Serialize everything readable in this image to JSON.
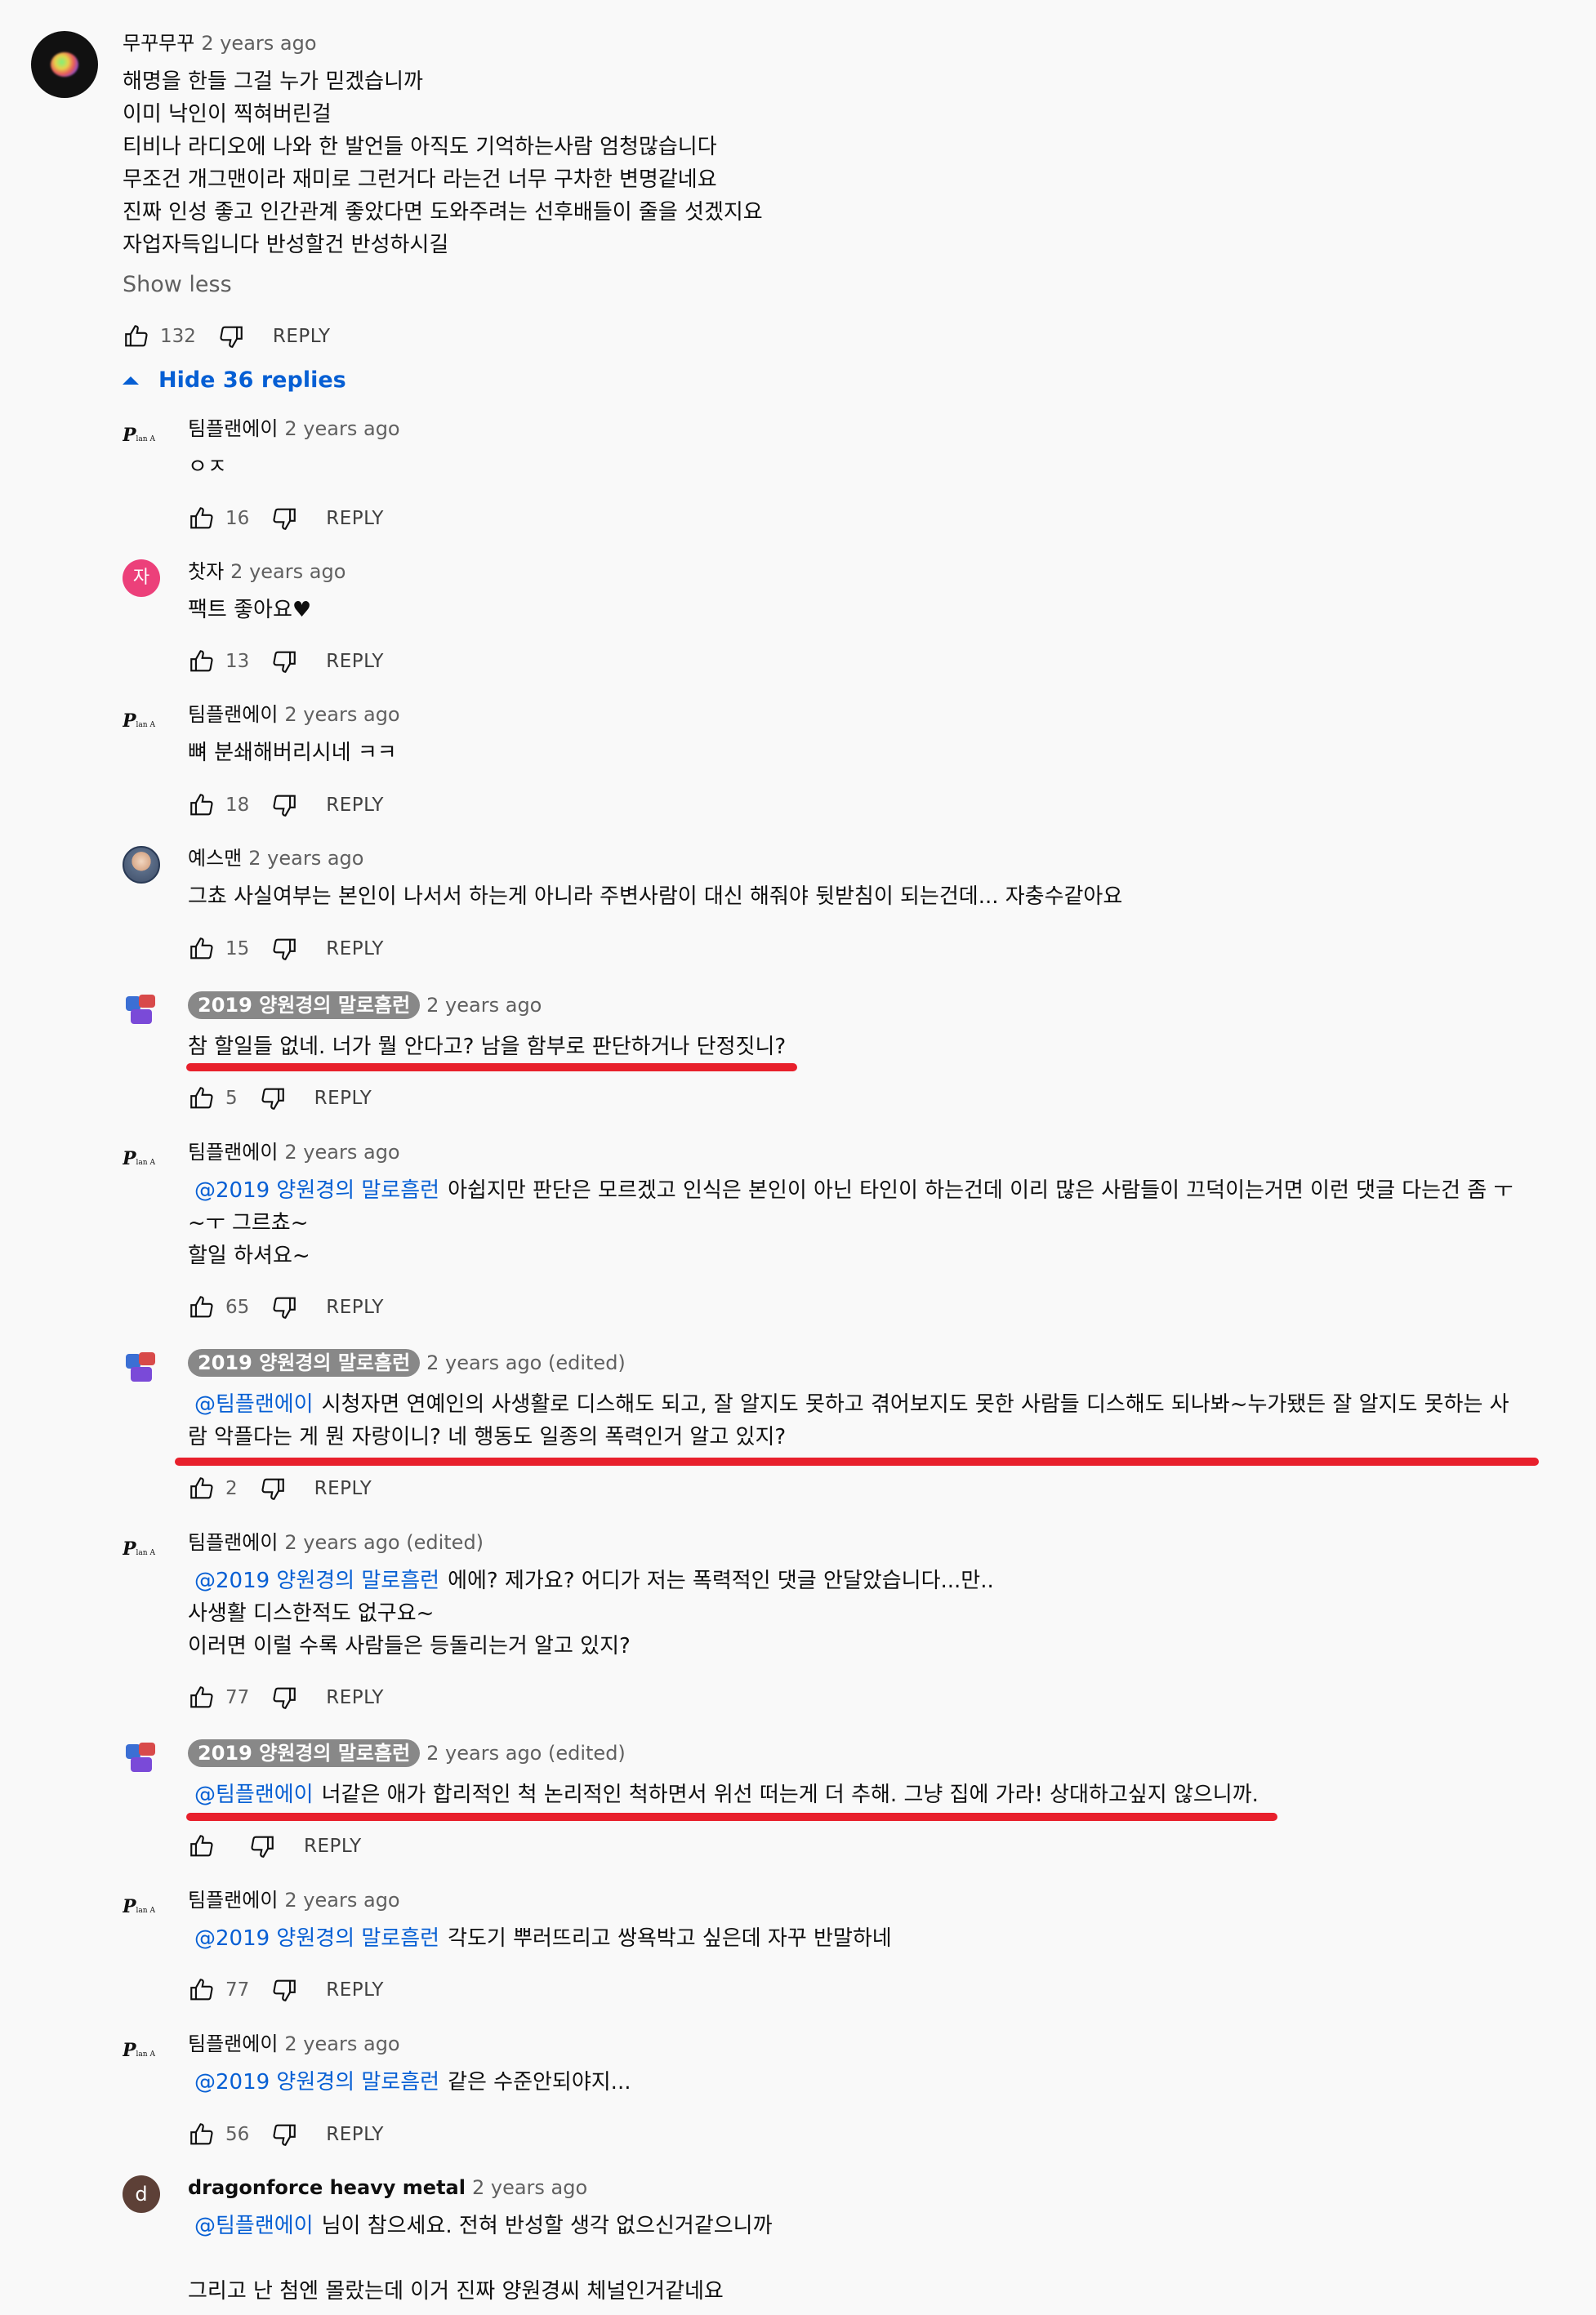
{
  "main_comment": {
    "author": "무꾸무꾸",
    "time": "2 years ago",
    "lines": [
      "해명을 한들 그걸 누가 믿겠습니까",
      "이미 낙인이 찍혀버린걸",
      "티비나 라디오에 나와 한 발언들 아직도 기억하는사람 엄청많습니다",
      "무조건 개그맨이라 재미로 그런거다 라는건 너무 구차한 변명같네요",
      "진짜 인성 좋고 인간관계 좋았다면 도와주려는 선후배들이 줄을 섯겠지요",
      "자업자득입니다 반성할건 반성하시길"
    ],
    "show_less": "Show less",
    "likes": "132",
    "reply_label": "REPLY",
    "hide_replies": "Hide 36 replies"
  },
  "replies": [
    {
      "author": "팀플랜에이",
      "time": "2 years ago",
      "text": "ㅇㅈ",
      "likes": "16",
      "reply_label": "REPLY"
    },
    {
      "author": "찻자",
      "avatar_letter": "자",
      "time": "2 years ago",
      "text": "팩트 좋아요♥",
      "likes": "13",
      "reply_label": "REPLY"
    },
    {
      "author": "팀플랜에이",
      "time": "2 years ago",
      "text": "뼈 분쇄해버리시네 ㅋㅋ",
      "likes": "18",
      "reply_label": "REPLY"
    },
    {
      "author": "예스맨",
      "time": "2 years ago",
      "text": "그쵸 사실여부는 본인이 나서서 하는게 아니라 주변사람이 대신 해줘야 뒷받침이 되는건데... 자충수같아요",
      "likes": "15",
      "reply_label": "REPLY"
    },
    {
      "author": "2019 양원경의 말로흠런",
      "time": "2 years ago",
      "text": "참 할일들 없네. 너가 뭘 안다고? 남을 함부로 판단하거나 단정짓니?",
      "likes": "5",
      "reply_label": "REPLY"
    },
    {
      "author": "팀플랜에이",
      "time": "2 years ago",
      "mention": "@2019 양원경의 말로흠런",
      "text": "아쉽지만 판단은 모르겠고 인식은 본인이 아닌 타인이 하는건데 이리 많은 사람들이 끄덕이는거면 이런 댓글 다는건 좀 ㅜ",
      "text2": "~ㅜ 그르쵸~",
      "text3": "할일 하셔요~",
      "likes": "65",
      "reply_label": "REPLY"
    },
    {
      "author": "2019 양원경의 말로흠런",
      "time": "2 years ago (edited)",
      "mention": "@팀플랜에이",
      "text": "시청자면 연예인의 사생활로 디스해도 되고, 잘 알지도 못하고 겪어보지도 못한 사람들 디스해도 되나봐~누가됐든 잘 알지도 못하는 사",
      "text2": "람 악플다는 게 뭔 자랑이니? 네 행동도 일종의 폭력인거 알고 있지?",
      "likes": "2",
      "reply_label": "REPLY"
    },
    {
      "author": "팀플랜에이",
      "time": "2 years ago (edited)",
      "mention": "@2019 양원경의 말로흠런",
      "text": "에에? 제가요?  어디가 저는 폭력적인 댓글 안달았습니다...만..",
      "text2": "사생활 디스한적도 없구요~",
      "text3": "이러면 이럴 수록 사람들은 등돌리는거 알고 있지?",
      "likes": "77",
      "reply_label": "REPLY"
    },
    {
      "author": "2019 양원경의 말로흠런",
      "time": "2 years ago (edited)",
      "mention": "@팀플랜에이",
      "text": "너같은 애가 합리적인 척 논리적인 척하면서 위선 떠는게 더 추해. 그냥 집에 가라! 상대하고싶지 않으니까.",
      "likes": "",
      "reply_label": "REPLY"
    },
    {
      "author": "팀플랜에이",
      "time": "2 years ago",
      "mention": "@2019 양원경의 말로흠런",
      "text": "각도기 뿌러뜨리고 쌍욕박고 싶은데 자꾸 반말하네",
      "likes": "77",
      "reply_label": "REPLY"
    },
    {
      "author": "팀플랜에이",
      "time": "2 years ago",
      "mention": "@2019 양원경의 말로흠런",
      "text": "같은 수준안되야지...",
      "likes": "56",
      "reply_label": "REPLY"
    },
    {
      "author": "dragonforce heavy metal",
      "avatar_letter": "d",
      "time": "2 years ago",
      "mention": "@팀플랜에이",
      "text": "님이 참으세요. 전혀 반성할 생각 없으신거같으니까",
      "text3": "그리고 난 첨엔 몰랐는데 이거 진짜 양원경씨 체널인거같네요"
    }
  ],
  "colors": {
    "mention": "#065fd4",
    "highlight": "#e8202c",
    "chip": "#888888"
  }
}
